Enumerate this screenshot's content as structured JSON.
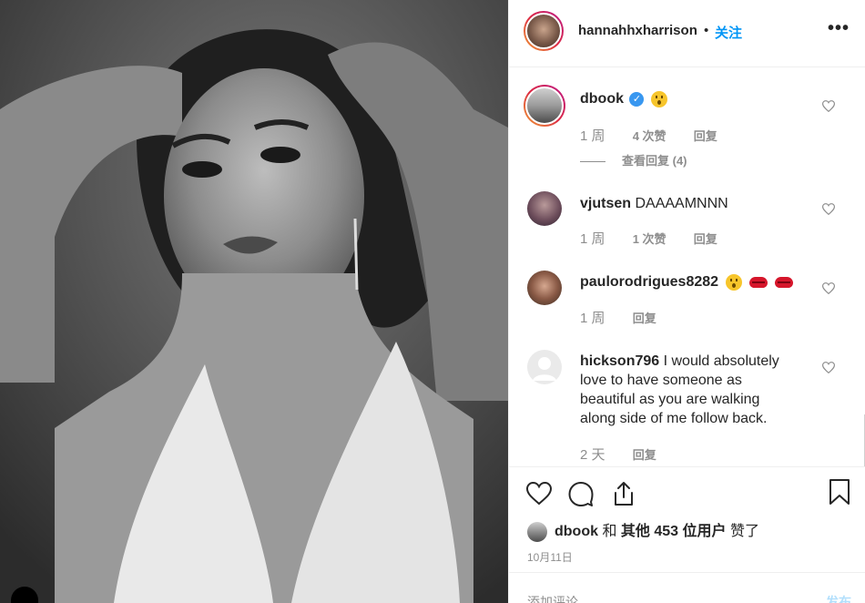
{
  "post": {
    "author": "hannahhxharrison",
    "separator": "•",
    "follow_label": "关注",
    "more_label": "•••"
  },
  "comments": [
    {
      "user": "dbook",
      "verified": true,
      "text": "",
      "time": "1 周",
      "likes": "4 次赞",
      "reply": "回复",
      "view_replies": "查看回复 (4)"
    },
    {
      "user": "vjutsen",
      "text": "DAAAAMNNN",
      "time": "1 周",
      "likes": "1 次赞",
      "reply": "回复"
    },
    {
      "user": "paulorodrigues8282",
      "text": "",
      "time": "1 周",
      "reply": "回复"
    },
    {
      "user": "hickson796",
      "text": "I would absolutely love to have someone as beautiful as you are walking along side of me follow back.",
      "time": "2 天",
      "reply": "回复"
    }
  ],
  "likes_summary": {
    "user": "dbook",
    "connector": "和",
    "others": "其他 453 位用户",
    "suffix": "赞了"
  },
  "date": "10月11日",
  "add_comment": {
    "placeholder": "添加评论...",
    "post_label": "发布"
  },
  "colors": {
    "link_blue": "#0095f6",
    "verified_blue": "#3897f0",
    "muted": "#8e8e8e",
    "text": "#262626"
  }
}
